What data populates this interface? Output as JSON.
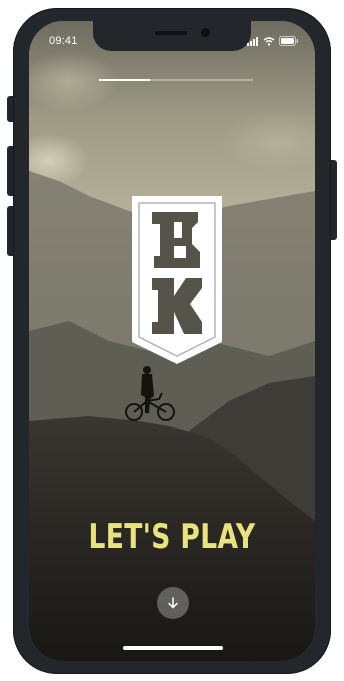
{
  "status_bar": {
    "time": "09:41",
    "icons": [
      "cellular-signal-icon",
      "wifi-icon",
      "battery-icon"
    ]
  },
  "onboarding": {
    "progress": 0.33,
    "logo": {
      "text": "BK",
      "icon": "shield-badge-icon",
      "color": "#ffffff"
    },
    "headline": "LET'S PLAY",
    "headline_color": "#e9e37f",
    "scroll_button_icon": "arrow-down-icon"
  },
  "colors": {
    "device_frame": "#23272c",
    "accent": "#e9e37f"
  }
}
